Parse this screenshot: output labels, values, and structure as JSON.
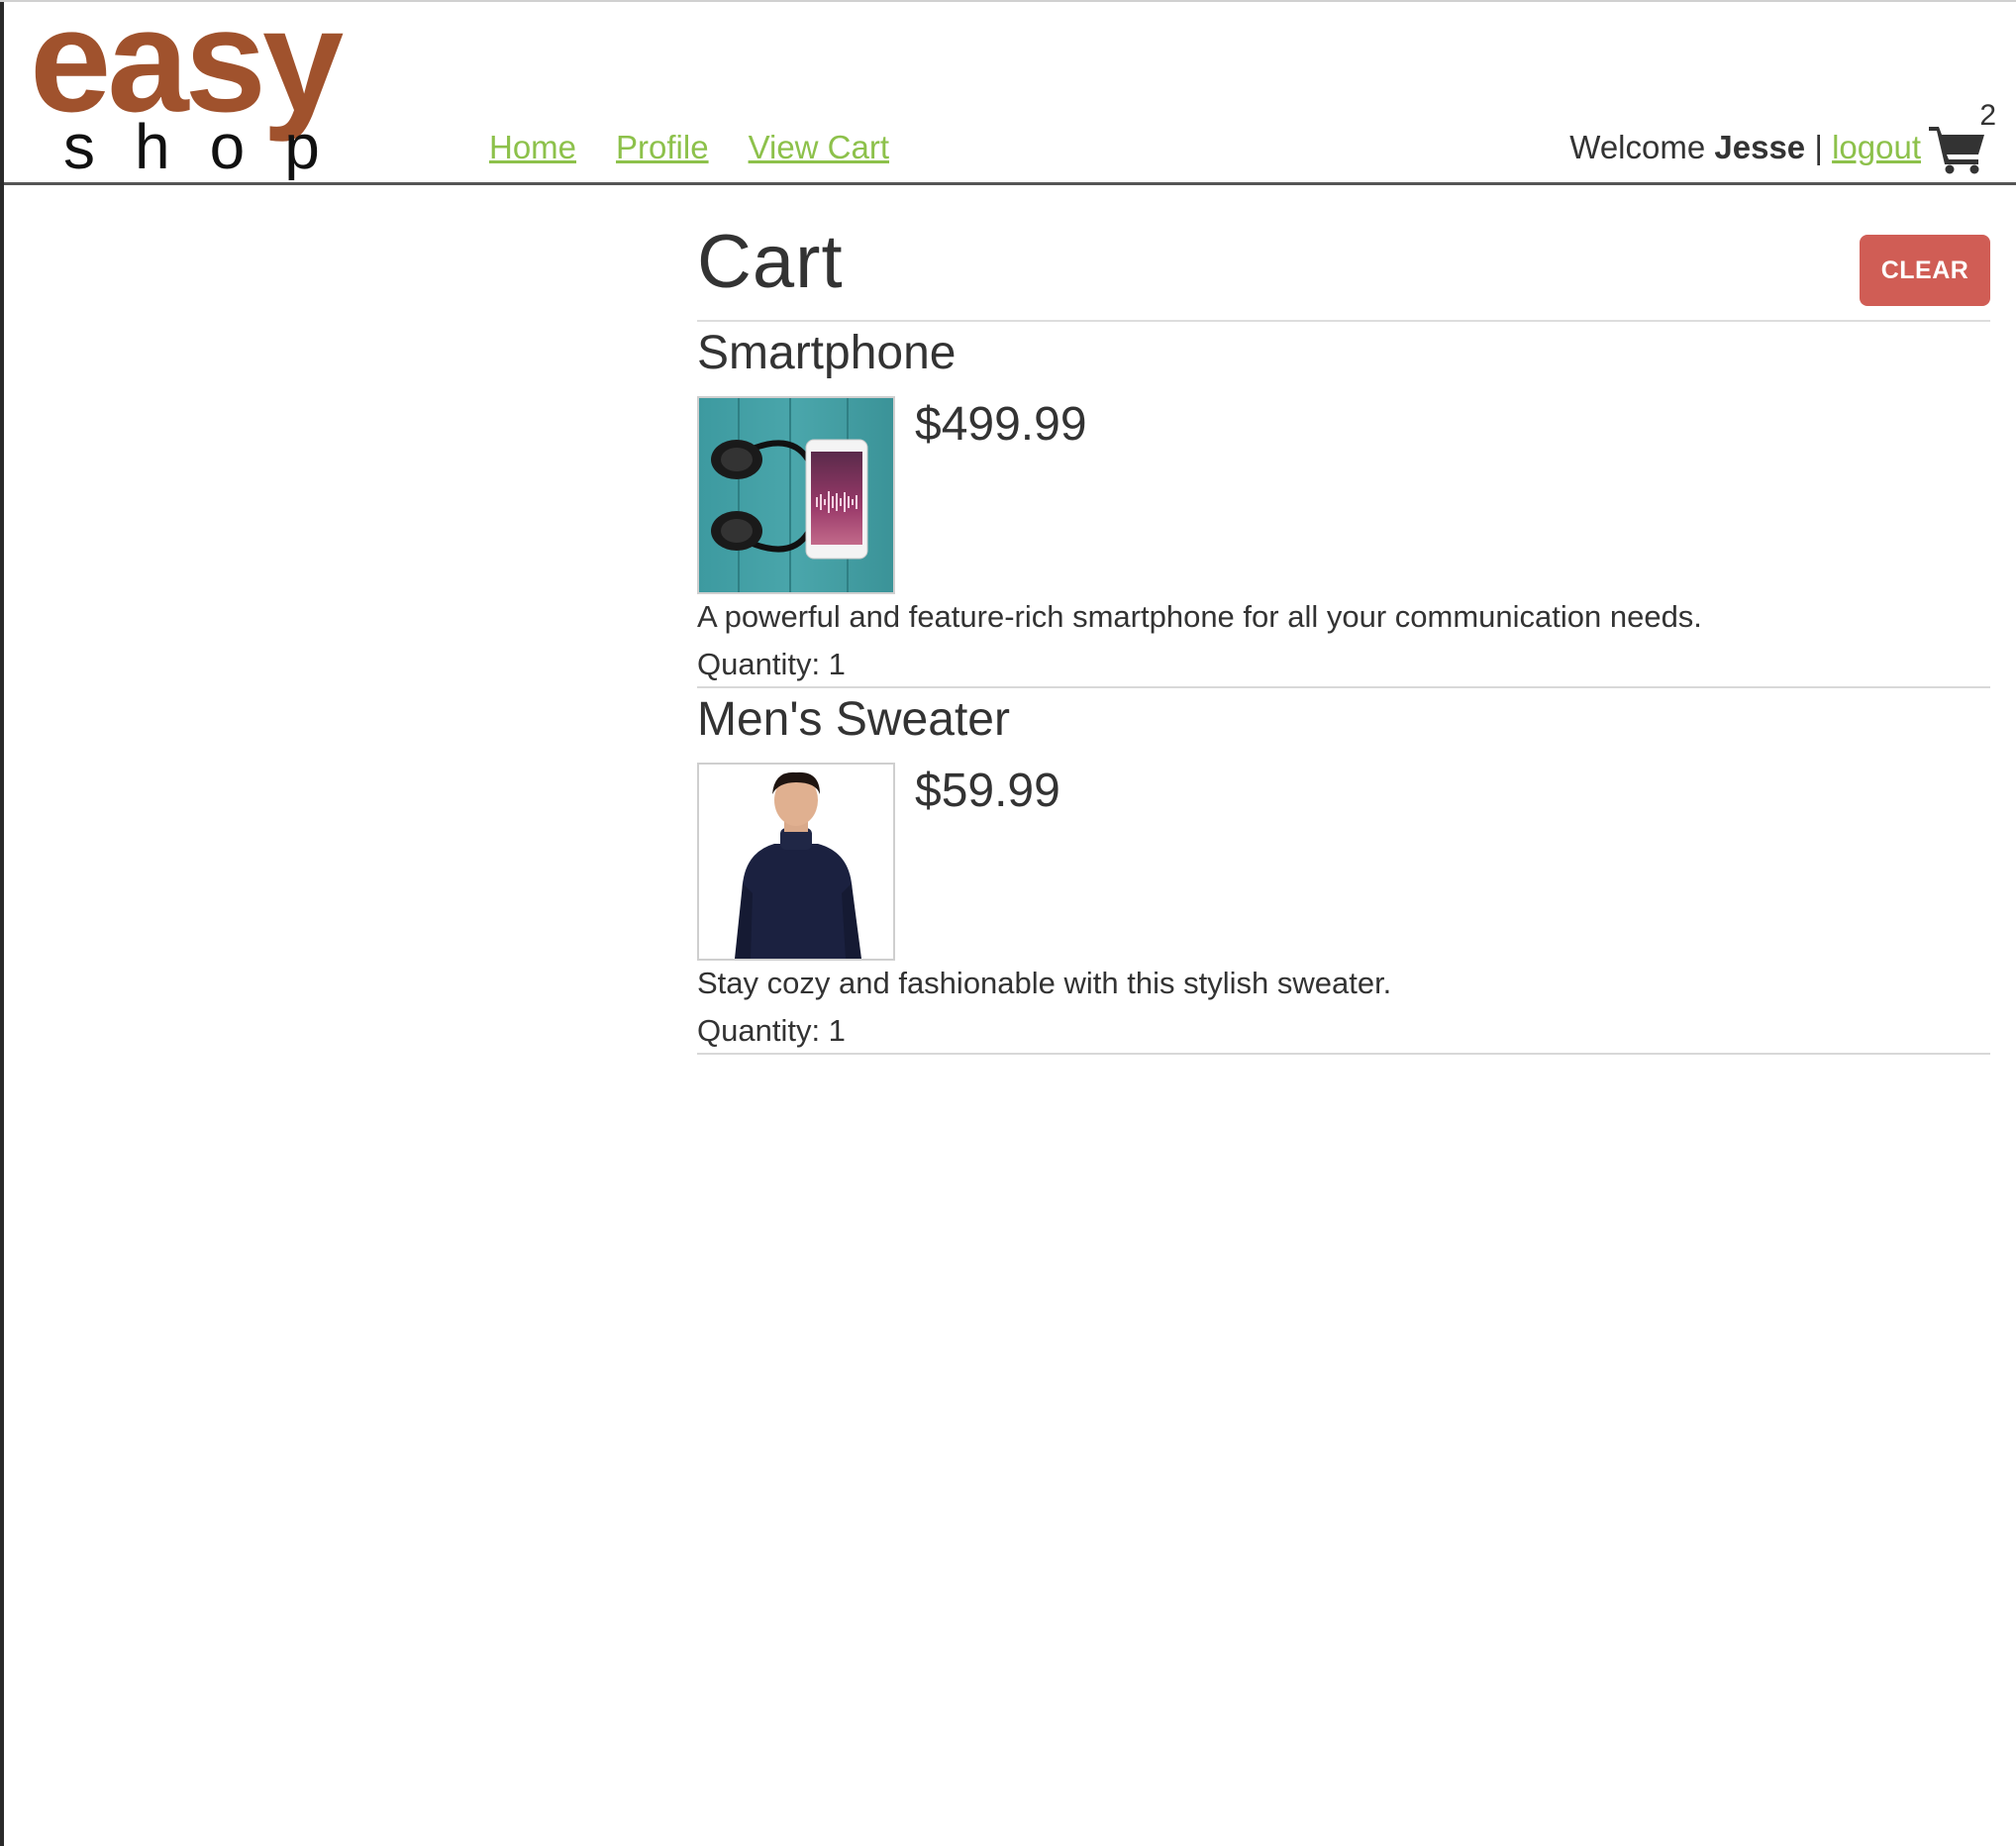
{
  "brand": {
    "logo_top": "easy",
    "logo_bottom": "shop",
    "logo_color": "#a0522d"
  },
  "nav": {
    "home": "Home",
    "profile": "Profile",
    "view_cart": "View Cart",
    "link_color": "#8dc14b"
  },
  "user": {
    "welcome": "Welcome",
    "name": "Jesse",
    "separator": "|",
    "logout": "logout"
  },
  "cart_badge": {
    "icon": "shopping-cart-icon",
    "count": "2"
  },
  "page": {
    "title": "Cart",
    "clear_label": "CLEAR",
    "clear_color": "#d05d55"
  },
  "items": [
    {
      "name": "Smartphone",
      "price": "$499.99",
      "description": "A powerful and feature-rich smartphone for all your communication needs.",
      "quantity_label": "Quantity: 1",
      "image": "smartphone-headphones-photo"
    },
    {
      "name": "Men's Sweater",
      "price": "$59.99",
      "description": "Stay cozy and fashionable with this stylish sweater.",
      "quantity_label": "Quantity: 1",
      "image": "mens-sweater-photo"
    }
  ]
}
